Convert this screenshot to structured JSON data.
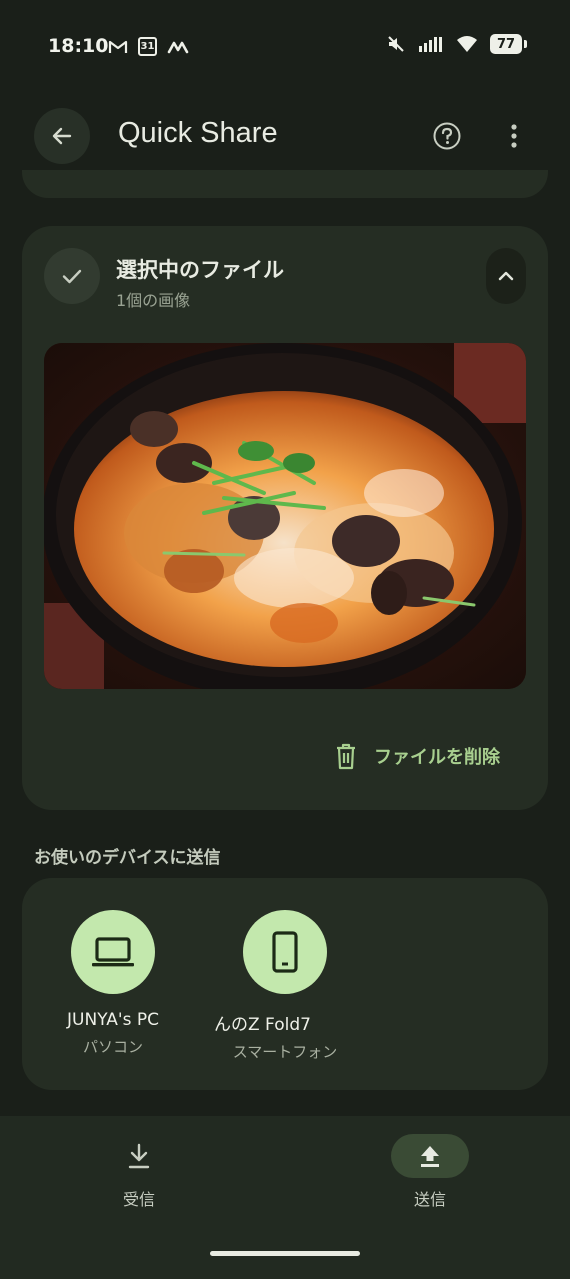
{
  "status_bar": {
    "time": "18:10",
    "left_icons": [
      "gmail-icon",
      "calendar-icon",
      "app-m-icon"
    ],
    "calendar_day": "31",
    "right_icons": [
      "mute-icon",
      "signal-icon",
      "wifi-icon",
      "battery-icon"
    ],
    "battery_level": "77"
  },
  "app_bar": {
    "title": "Quick Share"
  },
  "selected_files": {
    "title": "選択中のファイル",
    "subtitle": "1個の画像",
    "delete_label": "ファイルを削除"
  },
  "devices": {
    "section_title": "お使いのデバイスに送信",
    "items": [
      {
        "name": "JUNYA's PC",
        "type": "パソコン",
        "icon": "laptop-icon"
      },
      {
        "name": "んのZ Fold7",
        "type": "スマートフォン",
        "icon": "phone-icon"
      }
    ]
  },
  "bottom_nav": {
    "items": [
      {
        "label": "受信",
        "icon": "download-icon",
        "active": false
      },
      {
        "label": "送信",
        "icon": "upload-icon",
        "active": true
      }
    ]
  },
  "colors": {
    "background": "#1a1f19",
    "card": "#252d23",
    "accent": "#a8cf8f",
    "device_circle": "#c3e8ad"
  }
}
